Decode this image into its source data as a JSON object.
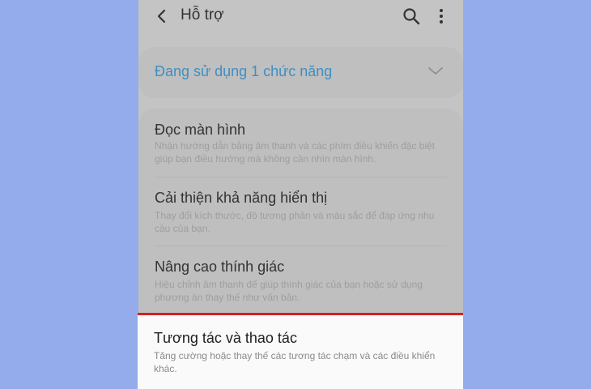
{
  "header": {
    "title": "Hỗ trợ",
    "icons": [
      "back-arrow-icon",
      "search-icon",
      "more-vertical-icon"
    ]
  },
  "status": {
    "label": "Đang sử dụng 1 chức năng",
    "color": "#3f8ec3"
  },
  "items": [
    {
      "title": "Đọc màn hình",
      "description": "Nhận hướng dẫn bằng âm thanh và các phím điều khiển đặc biệt giúp bạn điều hướng mà không cần nhìn màn hình."
    },
    {
      "title": "Cải thiện khả năng hiển thị",
      "description": "Thay đổi kích thước, độ tương phản và màu sắc để đáp ứng nhu cầu của bạn."
    },
    {
      "title": "Nâng cao thính giác",
      "description": "Hiệu chỉnh âm thanh để giúp thính giác của bạn hoặc sử dụng phương án thay thế như văn bản."
    },
    {
      "title": "Tương tác và thao tác",
      "description": "Tăng cường hoặc thay thế các tương tác chạm và các điều khiển khác."
    }
  ],
  "colors": {
    "page_background": "#94acec",
    "highlight_border": "#d6201f"
  }
}
